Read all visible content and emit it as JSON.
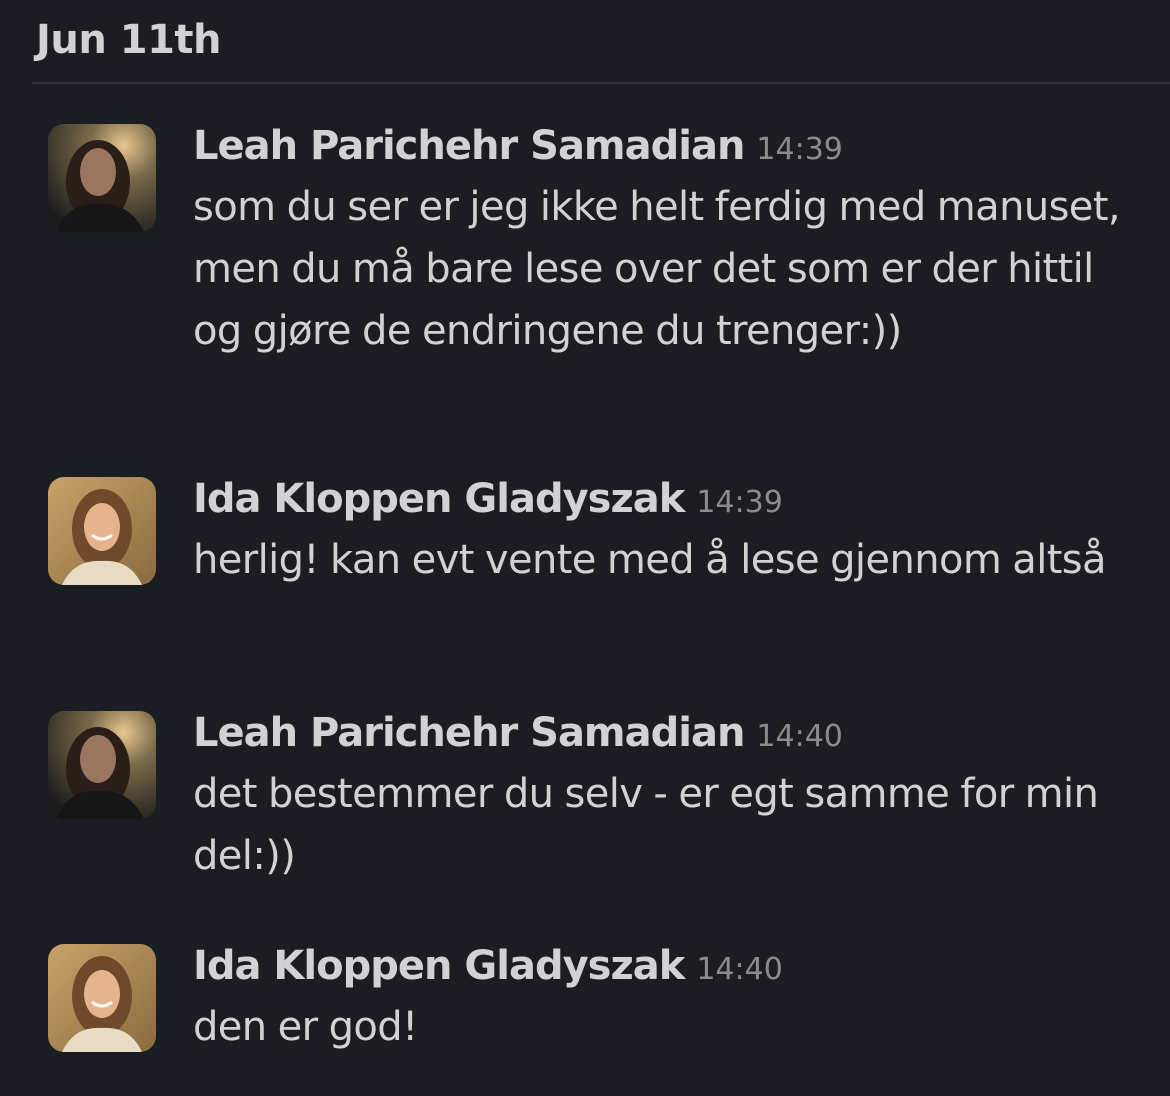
{
  "date_header": "Jun 11th",
  "messages": [
    {
      "author": "Leah Parichehr Samadian",
      "time": "14:39",
      "avatar_icon": "user-avatar-leah",
      "text": "som du ser er jeg ikke helt ferdig med manuset, men du må bare lese over det som er der hittil og gjøre de endringene du trenger:))"
    },
    {
      "author": "Ida Kloppen Gladyszak",
      "time": "14:39",
      "avatar_icon": "user-avatar-ida",
      "text": "herlig! kan evt vente med å lese gjennom altså"
    },
    {
      "author": "Leah Parichehr Samadian",
      "time": "14:40",
      "avatar_icon": "user-avatar-leah",
      "text": "det bestemmer du selv - er egt samme for min del:))"
    },
    {
      "author": "Ida Kloppen Gladyszak",
      "time": "14:40",
      "avatar_icon": "user-avatar-ida",
      "text": "den er god!"
    }
  ],
  "colors": {
    "background": "#1a1d21",
    "text": "#d1d2d3",
    "timestamp": "#8b8c8e",
    "divider": "#2c2f33"
  }
}
